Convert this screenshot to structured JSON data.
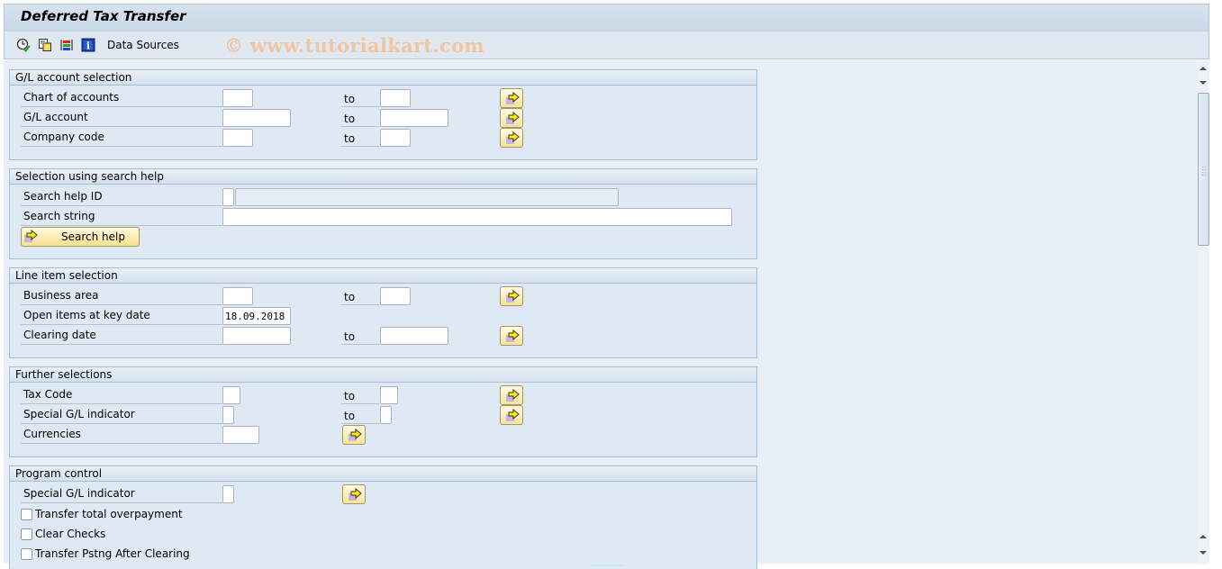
{
  "window": {
    "title": "Deferred Tax Transfer"
  },
  "toolbar": {
    "icons": [
      "execute-clock-icon",
      "copy-variant-icon",
      "selection-criteria-icon",
      "info-icon"
    ],
    "data_sources_label": "Data Sources",
    "watermark": "© www.tutorialkart.com"
  },
  "groups": {
    "gl_account": {
      "title": "G/L account selection",
      "rows": [
        {
          "label": "Chart of accounts",
          "from": "",
          "to_label": "to",
          "to": ""
        },
        {
          "label": "G/L account",
          "from": "",
          "to_label": "to",
          "to": ""
        },
        {
          "label": "Company code",
          "from": "",
          "to_label": "to",
          "to": ""
        }
      ]
    },
    "search_help": {
      "title": "Selection using search help",
      "search_help_id_label": "Search help ID",
      "search_help_id_value": "",
      "search_help_id_desc": "",
      "search_string_label": "Search string",
      "search_string_value": "",
      "search_button_label": "Search help"
    },
    "line_item": {
      "title": "Line item selection",
      "rows": [
        {
          "label": "Business area",
          "from": "",
          "to_label": "to",
          "to": ""
        },
        {
          "label": "Open items at key date",
          "value": "18.09.2018"
        },
        {
          "label": "Clearing date",
          "from": "",
          "to_label": "to",
          "to": ""
        }
      ]
    },
    "further": {
      "title": "Further selections",
      "rows": [
        {
          "label": "Tax Code",
          "from": "",
          "to_label": "to",
          "to": ""
        },
        {
          "label": "Special G/L indicator",
          "from": "",
          "to_label": "to",
          "to": ""
        },
        {
          "label": "Currencies",
          "value": ""
        }
      ]
    },
    "program_control": {
      "title": "Program control",
      "special_gl_label": "Special G/L indicator",
      "special_gl_value": "",
      "checkboxes": [
        {
          "label": "Transfer total overpayment",
          "checked": false
        },
        {
          "label": "Clear Checks",
          "checked": false
        },
        {
          "label": "Transfer Pstng After Clearing",
          "checked": false
        }
      ]
    }
  }
}
